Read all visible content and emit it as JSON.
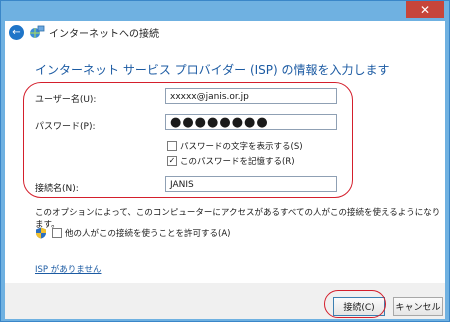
{
  "window": {
    "title": "インターネットへの接続",
    "close_glyph": "✕",
    "back_glyph": "←"
  },
  "form": {
    "heading": "インターネット サービス プロバイダー (ISP) の情報を入力します",
    "username_label": "ユーザー名(U):",
    "username_value": "xxxxx@janis.or.jp",
    "password_label": "パスワード(P):",
    "password_value": "●●●●●●●●",
    "show_password_label": "パスワードの文字を表示する(S)",
    "show_password_checked": false,
    "remember_password_label": "このパスワードを記憶する(R)",
    "remember_password_checked": true,
    "connection_name_label": "接続名(N):",
    "connection_name_value": "JANIS"
  },
  "info": {
    "text": "このオプションによって、このコンピューターにアクセスがあるすべての人がこの接続を使えるようになります。",
    "share_label": "他の人がこの接続を使うことを許可する(A)",
    "share_checked": false
  },
  "link": {
    "no_isp": "ISP がありません"
  },
  "buttons": {
    "connect": "接続(C)",
    "cancel": "キャンセル"
  },
  "colors": {
    "accent": "#1c5ba3",
    "highlight": "#d41f2c",
    "background": "#6fb1e1",
    "close_button": "#c7453a"
  }
}
